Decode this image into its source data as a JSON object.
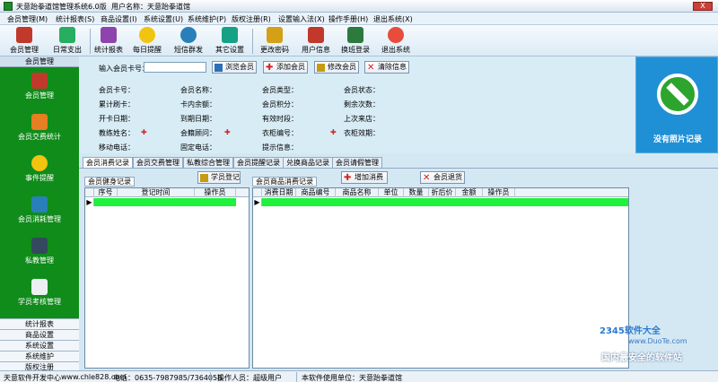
{
  "window": {
    "title": "天意跆拳道馆管理系统6.0版",
    "user_label": "用户名称：天意跆拳道馆",
    "close_label": "X"
  },
  "menu": [
    "会员管理(M)",
    "统计报表(S)",
    "商品设置(I)",
    "系统设置(U)",
    "系统维护(P)",
    "版权注册(R)",
    "设置输入法(X)",
    "操作手册(H)",
    "退出系统(X)"
  ],
  "toolbar": [
    {
      "label": "会员管理",
      "icon": "gift-icon",
      "color": "#c0392b"
    },
    {
      "label": "日常支出",
      "icon": "money-icon",
      "color": "#27ae60"
    },
    {
      "label": "统计报表",
      "icon": "report-icon",
      "color": "#8e44ad"
    },
    {
      "label": "每日提醒",
      "icon": "bulb-icon",
      "color": "#f1c40f"
    },
    {
      "label": "短信群发",
      "icon": "globe-icon",
      "color": "#2980b9"
    },
    {
      "label": "其它设置",
      "icon": "settings-icon",
      "color": "#16a085"
    },
    {
      "label": "更改密码",
      "icon": "key-icon",
      "color": "#d4a017"
    },
    {
      "label": "用户信息",
      "icon": "book-icon",
      "color": "#c0392b"
    },
    {
      "label": "换班登录",
      "icon": "handshake-icon",
      "color": "#2c7a3d"
    },
    {
      "label": "退出系统",
      "icon": "power-icon",
      "color": "#e74c3c"
    }
  ],
  "sidebar": {
    "header": "会员管理",
    "items": [
      {
        "label": "会员管理",
        "icon": "gift-icon",
        "color": "#c0392b"
      },
      {
        "label": "会员交费统计",
        "icon": "money-icon",
        "color": "#e67e22"
      },
      {
        "label": "事件提醒",
        "icon": "bulb-icon",
        "color": "#f1c40f"
      },
      {
        "label": "会员消耗管理",
        "icon": "members-icon",
        "color": "#2980b9"
      },
      {
        "label": "私教管理",
        "icon": "coach-icon",
        "color": "#34495e"
      },
      {
        "label": "学员考核管理",
        "icon": "exam-icon",
        "color": "#ecf0f1"
      }
    ],
    "categories": [
      "统计报表",
      "商品设置",
      "系统设置",
      "系统维护",
      "版权注册"
    ]
  },
  "form": {
    "card_label": "输入会员卡号：",
    "card_value": "",
    "buttons": [
      {
        "label": "浏览会员",
        "icon": "browse-icon",
        "color": "#2c6fb7"
      },
      {
        "label": "添加会员",
        "icon": "add-icon",
        "color": "#d22222"
      },
      {
        "label": "修改会员",
        "icon": "edit-icon",
        "color": "#c79a11"
      },
      {
        "label": "清除信息",
        "icon": "clear-icon",
        "color": "#cc1f1f"
      }
    ],
    "rows": [
      [
        "会员卡号：",
        "会员名称：",
        "会员类型：",
        "会员状态："
      ],
      [
        "累计刷卡：",
        "卡内余额：",
        "会员积分：",
        "剩余次数："
      ],
      [
        "开卡日期：",
        "到期日期：",
        "有效时段：",
        "上次来店："
      ],
      [
        "教练姓名：",
        "会籍顾问：",
        "衣柜编号：",
        "衣柜效期："
      ],
      [
        "移动电话：",
        "固定电话：",
        "提示信息：",
        ""
      ]
    ]
  },
  "photo": {
    "no_photo_label": "没有照片记录"
  },
  "tabs": [
    "会员消费记录",
    "会员交费管理",
    "私教综合管理",
    "会员提醒记录",
    "兑换商品记录",
    "会员请假管理"
  ],
  "left_panel": {
    "subtab": "会员健身记录",
    "button": "学员登记",
    "columns": [
      "序号",
      "登记时间",
      "操作员"
    ]
  },
  "right_panel": {
    "subtab": "会员商品消费记录",
    "add_button": "增加消费",
    "return_button": "会员退货",
    "columns": [
      "消费日期",
      "商品编号",
      "商品名称",
      "单位",
      "数量",
      "折后价",
      "金额",
      "操作员"
    ]
  },
  "status": {
    "developer": "天意软件开发中心",
    "website": "www.chle828.com",
    "phone": "电话：0635-7987985/7364058",
    "operator": "操作人员：超级用户",
    "licensed": "本软件使用单位：天意跆拳道馆"
  },
  "watermark": {
    "brand": "2345软件大全",
    "url": "www.DuoTe.com",
    "tagline": "国内最安全的软件站"
  }
}
